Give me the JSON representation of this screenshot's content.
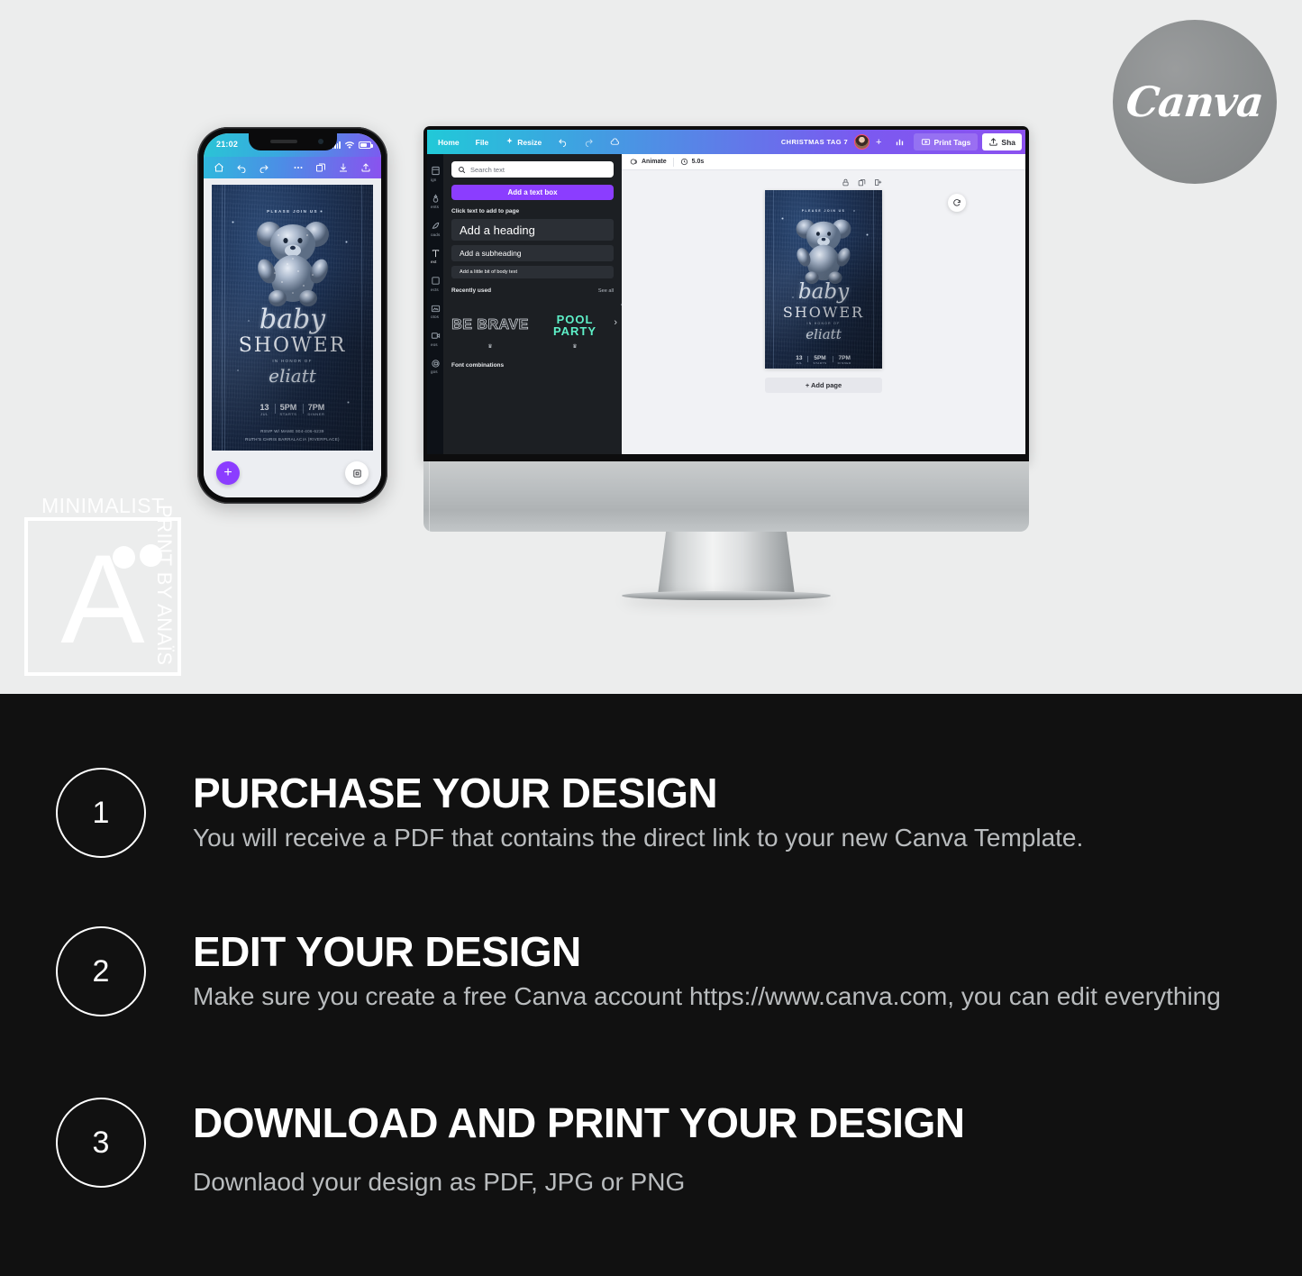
{
  "branding": {
    "canva_badge_text": "Canva",
    "watermark_line1": "MINIMALIST",
    "watermark_line2": "PRINT BY ANAÏS",
    "watermark_logo_letter": "A"
  },
  "phone": {
    "status_time": "21:02",
    "toolbar_icons": [
      "home-icon",
      "undo-icon",
      "redo-icon",
      "more-icon",
      "layers-icon",
      "download-icon",
      "share-icon"
    ],
    "fab_label": "+",
    "page_button_icon": "pages-icon"
  },
  "design": {
    "join_us": "PLEASE JOIN US",
    "title_script": "baby",
    "title_serif": "SHOWER",
    "honor_label": "IN HONOR OF",
    "honor_name": "eliatt",
    "details": [
      {
        "big": "13",
        "small": "JUL"
      },
      {
        "big": "5PM",
        "small": "STARTS"
      },
      {
        "big": "7PM",
        "small": "DINNER"
      }
    ],
    "rsvp_line1": "RSVP W/ MAME 904-406-6239",
    "rsvp_line2": "RUTH'S CHRIS BARRALACIA (RIVERPLACE)"
  },
  "canva_editor": {
    "top_bar": {
      "home": "Home",
      "file": "File",
      "resize": "Resize",
      "undo_icon": "undo-icon",
      "redo_icon": "redo-icon",
      "cloud_icon": "cloud-saved-icon",
      "doc_title": "CHRISTMAS TAG 7",
      "plus": "+",
      "insights_icon": "insights-icon",
      "print_tags": "Print Tags",
      "share": "Sha"
    },
    "rail": [
      {
        "label": "ign",
        "icon": "design-icon"
      },
      {
        "label": "ents",
        "icon": "elements-icon"
      },
      {
        "label": "oads",
        "icon": "uploads-icon"
      },
      {
        "label": "ext",
        "icon": "text-icon"
      },
      {
        "label": "ects",
        "icon": "projects-icon"
      },
      {
        "label": "otos",
        "icon": "photos-icon"
      },
      {
        "label": "eos",
        "icon": "videos-icon"
      },
      {
        "label": "gos",
        "icon": "logos-icon"
      }
    ],
    "text_panel": {
      "search_placeholder": "Search text",
      "add_text_box": "Add a text box",
      "click_hint": "Click text to add to page",
      "preset_heading": "Add a heading",
      "preset_subheading": "Add a subheading",
      "preset_body": "Add a little bit of body text",
      "recently_used": "Recently used",
      "see_all": "See all",
      "recent_items": [
        "BE BRAVE",
        "POOL PARTY"
      ],
      "font_combinations": "Font combinations"
    },
    "editor_toolbar": {
      "animate": "Animate",
      "duration": "5.0s"
    },
    "canvas": {
      "page_tools": [
        "lock-icon",
        "duplicate-icon",
        "add-page-icon"
      ],
      "refresh_icon": "refresh-icon",
      "add_page": "+ Add page"
    }
  },
  "steps": [
    {
      "number": "1",
      "title": "PURCHASE YOUR DESIGN",
      "body": "You will receive a PDF that contains the direct link to your new Canva Template."
    },
    {
      "number": "2",
      "title": "EDIT YOUR DESIGN",
      "body": "Make sure you create a free Canva account https://www.canva.com, you can edit everything"
    },
    {
      "number": "3",
      "title": "DOWNLOAD AND PRINT  YOUR DESIGN",
      "body": "Downlaod your design as PDF, JPG or PNG"
    }
  ],
  "colors": {
    "page_bg": "#eceded",
    "dark_section": "#111111",
    "canva_purple": "#8b3dff",
    "panel_bg": "#1c1f23",
    "accent_teal": "#5ef0c8",
    "denim": "#16253f"
  }
}
